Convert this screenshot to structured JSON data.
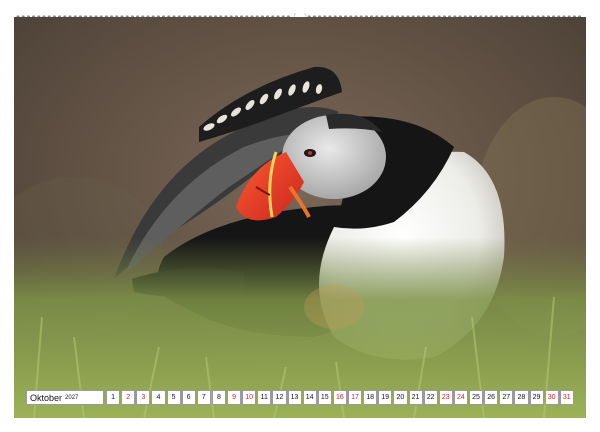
{
  "calendar": {
    "month": "Oktober",
    "year": "2027",
    "days": [
      "1",
      "2",
      "3",
      "4",
      "5",
      "6",
      "7",
      "8",
      "9",
      "10",
      "11",
      "12",
      "13",
      "14",
      "15",
      "16",
      "17",
      "18",
      "19",
      "20",
      "21",
      "22",
      "23",
      "24",
      "25",
      "26",
      "27",
      "28",
      "29",
      "30",
      "31"
    ],
    "weekend_days": [
      "2",
      "3",
      "9",
      "10",
      "16",
      "17",
      "23",
      "24",
      "30",
      "31"
    ]
  },
  "colors": {
    "weekend": "#d0202a",
    "beak_orange": "#f0442a",
    "background_brown": "#6b5a4a",
    "grass_green": "#8aa04a"
  }
}
